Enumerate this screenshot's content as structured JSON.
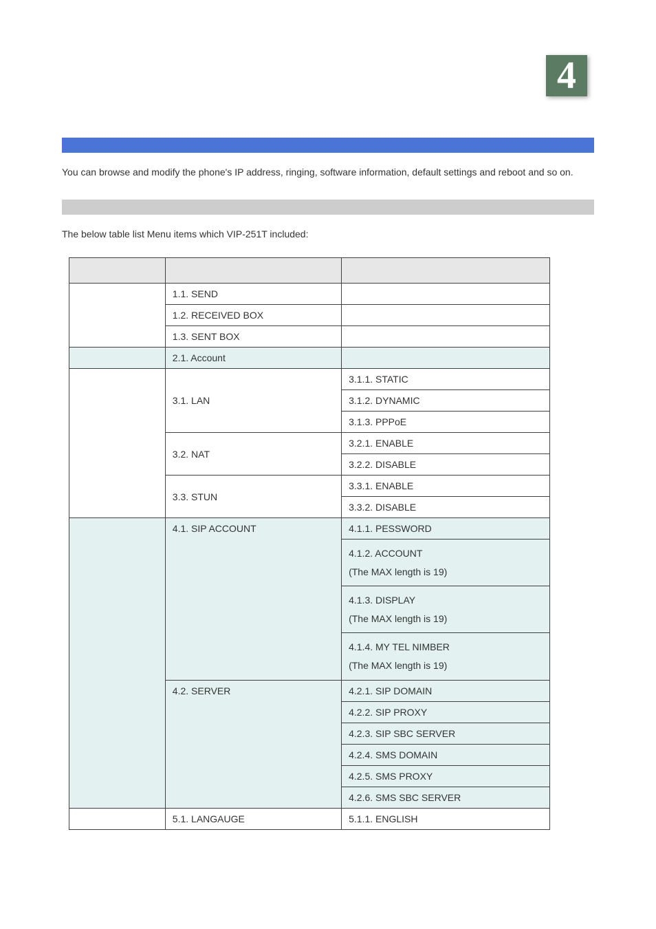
{
  "chapter_number": "4",
  "intro_text": "You can browse and modify the phone's IP address, ringing, software information, default settings and reboot and so on.",
  "sub_text": "The below table list Menu items which VIP-251T included:",
  "header": {
    "col1": "",
    "col2": "",
    "col3": ""
  },
  "rows": {
    "r1_send": "1.1. SEND",
    "r1_recv": "1.2. RECEIVED BOX",
    "r1_sent": "1.3. SENT BOX",
    "r2_account": "2.1. Account",
    "r3_lan": "3.1. LAN",
    "r3_lan_static": "3.1.1. STATIC",
    "r3_lan_dynamic": "3.1.2. DYNAMIC",
    "r3_lan_pppoe": "3.1.3. PPPoE",
    "r3_nat": "3.2. NAT",
    "r3_nat_enable": "3.2.1. ENABLE",
    "r3_nat_disable": "3.2.2. DISABLE",
    "r3_stun": "3.3. STUN",
    "r3_stun_enable": "3.3.1. ENABLE",
    "r3_stun_disable": "3.3.2. DISABLE",
    "r4_sipacct": "4.1. SIP ACCOUNT",
    "r4_sip_pw": "4.1.1. PESSWORD",
    "r4_sip_account_a": "4.1.2. ACCOUNT",
    "r4_sip_account_b": "(The MAX length is 19)",
    "r4_sip_display_a": "4.1.3. DISPLAY",
    "r4_sip_display_b": "(The MAX length is 19)",
    "r4_sip_tel_a": "4.1.4. MY TEL NIMBER",
    "r4_sip_tel_b": "(The MAX length is 19)",
    "r4_server": "4.2. SERVER",
    "r4_srv_domain": "4.2.1. SIP DOMAIN",
    "r4_srv_proxy": "4.2.2. SIP PROXY",
    "r4_srv_sbc": "4.2.3. SIP SBC SERVER",
    "r4_srv_smsdomain": "4.2.4. SMS DOMAIN",
    "r4_srv_smsproxy": "4.2.5. SMS PROXY",
    "r4_srv_smssbc": "4.2.6. SMS SBC SERVER",
    "r5_lang": "5.1. LANGAUGE",
    "r5_lang_en": "5.1.1. ENGLISH"
  }
}
